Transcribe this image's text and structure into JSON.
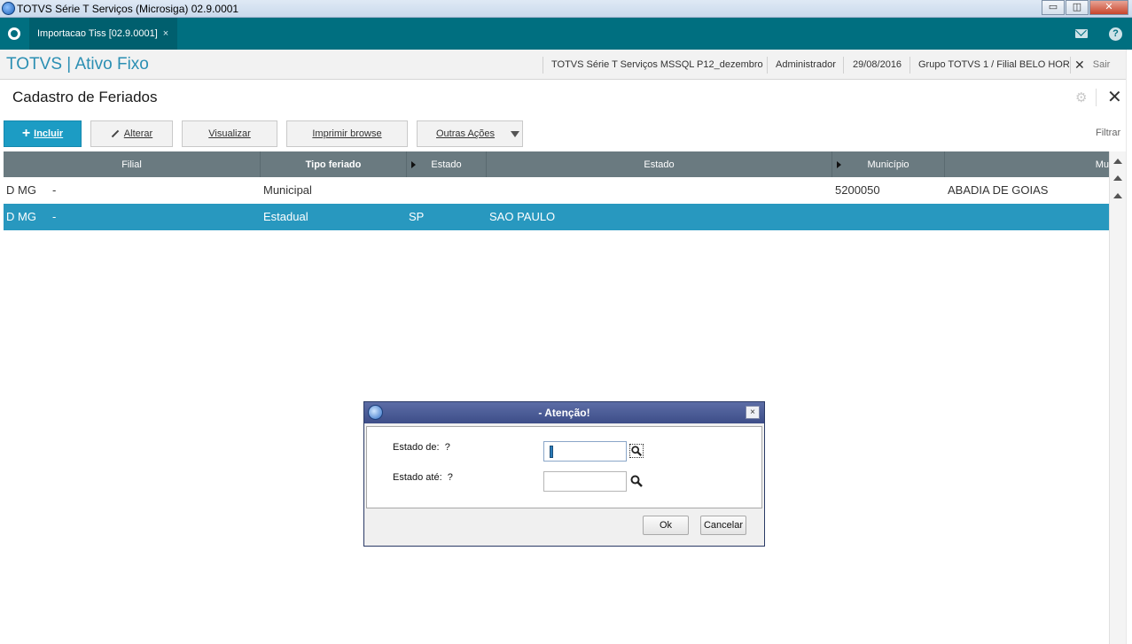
{
  "window": {
    "title": "TOTVS Série T Serviços (Microsiga) 02.9.0001",
    "minimize": "▭",
    "maximize": "◫",
    "close": "✕"
  },
  "tabbar": {
    "active_tab": "Importacao Tiss [02.9.0001]",
    "tab_close": "×",
    "help": "?"
  },
  "header": {
    "brand": "TOTVS | Ativo Fixo",
    "environment": "TOTVS Série T Serviços MSSQL P12_dezembro",
    "user": "Administrador",
    "date": "29/08/2016",
    "company": "Grupo TOTVS 1 / Filial BELO HOR",
    "exit": "Sair",
    "exit_icon": "✕"
  },
  "page": {
    "title": "Cadastro de Feriados",
    "gear": "⚙",
    "close": "✕"
  },
  "toolbar": {
    "incluir": "Incluir",
    "alterar": "Alterar",
    "visualizar": "Visualizar",
    "imprimir": "Imprimir browse",
    "outras": "Outras Ações",
    "filtrar": "Filtrar"
  },
  "grid": {
    "columns": [
      "Filial",
      "Tipo feriado",
      "Estado",
      "Estado",
      "Município",
      "Mu"
    ],
    "rows": [
      {
        "filial": "D MG",
        "sep": "-",
        "tipo": "Municipal",
        "uf": "",
        "estado": "",
        "municipio_cod": "5200050",
        "municipio": "ABADIA DE GOIAS"
      },
      {
        "filial": "D MG",
        "sep": "-",
        "tipo": "Estadual",
        "uf": "SP",
        "estado": "SAO PAULO",
        "municipio_cod": "",
        "municipio": ""
      }
    ],
    "selected_row": 1,
    "colors": {
      "header": "#6a7a80",
      "selected": "#2898bf"
    }
  },
  "dialog": {
    "title": "- Atenção!",
    "close": "×",
    "field1_label": "Estado de:",
    "field1_q": "?",
    "field1_value": "",
    "field2_label": "Estado até:",
    "field2_q": "?",
    "field2_value": "",
    "ok": "Ok",
    "cancel": "Cancelar"
  }
}
